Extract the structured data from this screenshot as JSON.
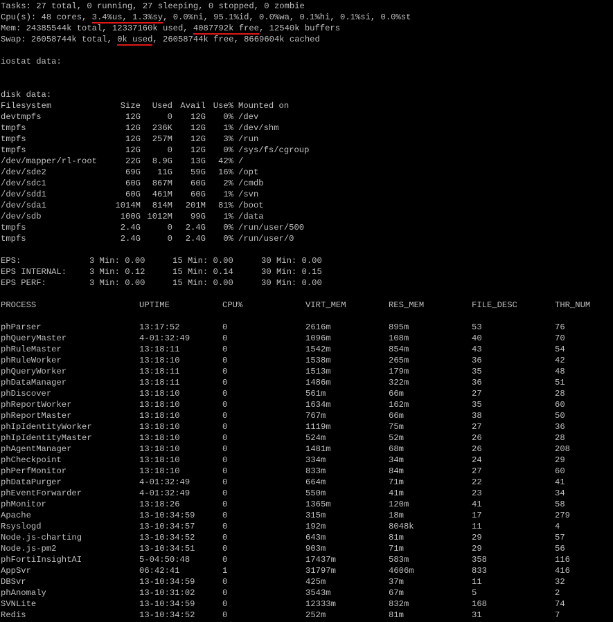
{
  "top": {
    "tasks": "Tasks: 27 total, 0 running, 27 sleeping, 0 stopped, 0 zombie",
    "cpu_prefix": "Cpu(s): 48 cores, ",
    "cpu_us_sy": "3.4%us, 1.3%sy",
    "cpu_rest": ", 0.0%ni, 95.1%id, 0.0%wa, 0.1%hi, 0.1%si, 0.0%st",
    "mem_prefix": "Mem: 24385544k total, 12337160k used, ",
    "mem_free": "4087792k free",
    "mem_rest": ", 12540k buffers",
    "swap_prefix": "Swap: 26058744k total, ",
    "swap_used": "0k used",
    "swap_rest": ", 26058744k free, 8669604k cached"
  },
  "iostat_label": "iostat data:",
  "disk": {
    "label": "disk data:",
    "headers": [
      "Filesystem",
      "Size",
      "Used",
      "Avail",
      "Use%",
      "Mounted on"
    ],
    "rows": [
      [
        "devtmpfs",
        "12G",
        "0",
        "12G",
        "0%",
        "/dev"
      ],
      [
        "tmpfs",
        "12G",
        "236K",
        "12G",
        "1%",
        "/dev/shm"
      ],
      [
        "tmpfs",
        "12G",
        "257M",
        "12G",
        "3%",
        "/run"
      ],
      [
        "tmpfs",
        "12G",
        "0",
        "12G",
        "0%",
        "/sys/fs/cgroup"
      ],
      [
        "/dev/mapper/rl-root",
        "22G",
        "8.9G",
        "13G",
        "42%",
        "/"
      ],
      [
        "/dev/sde2",
        "69G",
        "11G",
        "59G",
        "16%",
        "/opt"
      ],
      [
        "/dev/sdc1",
        "60G",
        "867M",
        "60G",
        "2%",
        "/cmdb"
      ],
      [
        "/dev/sdd1",
        "60G",
        "461M",
        "60G",
        "1%",
        "/svn"
      ],
      [
        "/dev/sda1",
        "1014M",
        "814M",
        "201M",
        "81%",
        "/boot"
      ],
      [
        "/dev/sdb",
        "100G",
        "1012M",
        "99G",
        "1%",
        "/data"
      ],
      [
        "tmpfs",
        "2.4G",
        "0",
        "2.4G",
        "0%",
        "/run/user/500"
      ],
      [
        "tmpfs",
        "2.4G",
        "0",
        "2.4G",
        "0%",
        "/run/user/0"
      ]
    ]
  },
  "eps": [
    [
      "EPS:",
      "3 Min: 0.00",
      "15 Min: 0.00",
      "30 Min: 0.00"
    ],
    [
      "EPS INTERNAL:",
      "3 Min: 0.12",
      "15 Min: 0.14",
      "30 Min: 0.15"
    ],
    [
      "EPS PERF:",
      "3 Min: 0.00",
      "15 Min: 0.00",
      "30 Min: 0.00"
    ]
  ],
  "process": {
    "headers": [
      "PROCESS",
      "UPTIME",
      "CPU%",
      "VIRT_MEM",
      "RES_MEM",
      "FILE_DESC",
      "THR_NUM"
    ],
    "rows": [
      [
        "phParser",
        "13:17:52",
        "0",
        "2616m",
        "895m",
        "53",
        "76"
      ],
      [
        "phQueryMaster",
        "4-01:32:49",
        "0",
        "1096m",
        "108m",
        "40",
        "70"
      ],
      [
        "phRuleMaster",
        "13:18:11",
        "0",
        "1542m",
        "854m",
        "43",
        "54"
      ],
      [
        "phRuleWorker",
        "13:18:10",
        "0",
        "1538m",
        "265m",
        "36",
        "42"
      ],
      [
        "phQueryWorker",
        "13:18:11",
        "0",
        "1513m",
        "179m",
        "35",
        "48"
      ],
      [
        "phDataManager",
        "13:18:11",
        "0",
        "1486m",
        "322m",
        "36",
        "51"
      ],
      [
        "phDiscover",
        "13:18:10",
        "0",
        "561m",
        "66m",
        "27",
        "28"
      ],
      [
        "phReportWorker",
        "13:18:10",
        "0",
        "1634m",
        "162m",
        "35",
        "60"
      ],
      [
        "phReportMaster",
        "13:18:10",
        "0",
        "767m",
        "66m",
        "38",
        "50"
      ],
      [
        "phIpIdentityWorker",
        "13:18:10",
        "0",
        "1119m",
        "75m",
        "27",
        "36"
      ],
      [
        "phIpIdentityMaster",
        "13:18:10",
        "0",
        "524m",
        "52m",
        "26",
        "28"
      ],
      [
        "phAgentManager",
        "13:18:10",
        "0",
        "1481m",
        "68m",
        "26",
        "208"
      ],
      [
        "phCheckpoint",
        "13:18:10",
        "0",
        "334m",
        "34m",
        "24",
        "29"
      ],
      [
        "phPerfMonitor",
        "13:18:10",
        "0",
        "833m",
        "84m",
        "27",
        "60"
      ],
      [
        "phDataPurger",
        "4-01:32:49",
        "0",
        "664m",
        "71m",
        "22",
        "41"
      ],
      [
        "phEventForwarder",
        "4-01:32:49",
        "0",
        "550m",
        "41m",
        "23",
        "34"
      ],
      [
        "phMonitor",
        "13:18:26",
        "0",
        "1365m",
        "120m",
        "41",
        "58"
      ],
      [
        "Apache",
        "13-10:34:59",
        "0",
        "315m",
        "18m",
        "17",
        "279"
      ],
      [
        "Rsyslogd",
        "13-10:34:57",
        "0",
        "192m",
        "8048k",
        "11",
        "4"
      ],
      [
        "Node.js-charting",
        "13-10:34:52",
        "0",
        "643m",
        "81m",
        "29",
        "57"
      ],
      [
        "Node.js-pm2",
        "13-10:34:51",
        "0",
        "903m",
        "71m",
        "29",
        "56"
      ],
      [
        "phFortiInsightAI",
        "5-04:50:48",
        "0",
        "17437m",
        "583m",
        "358",
        "116"
      ],
      [
        "AppSvr",
        "06:42:41",
        "1",
        "31797m",
        "4606m",
        "833",
        "416"
      ],
      [
        "DBSvr",
        "13-10:34:59",
        "0",
        "425m",
        "37m",
        "11",
        "32"
      ],
      [
        "phAnomaly",
        "13-10:31:02",
        "0",
        "3543m",
        "67m",
        "5",
        "2"
      ],
      [
        "SVNLite",
        "13-10:34:59",
        "0",
        "12333m",
        "832m",
        "168",
        "74"
      ],
      [
        "Redis",
        "13-10:34:52",
        "0",
        "252m",
        "81m",
        "31",
        "7"
      ]
    ]
  },
  "colors": {
    "background": "#000000",
    "text": "#c0c0c0",
    "underline": "#e01818"
  }
}
